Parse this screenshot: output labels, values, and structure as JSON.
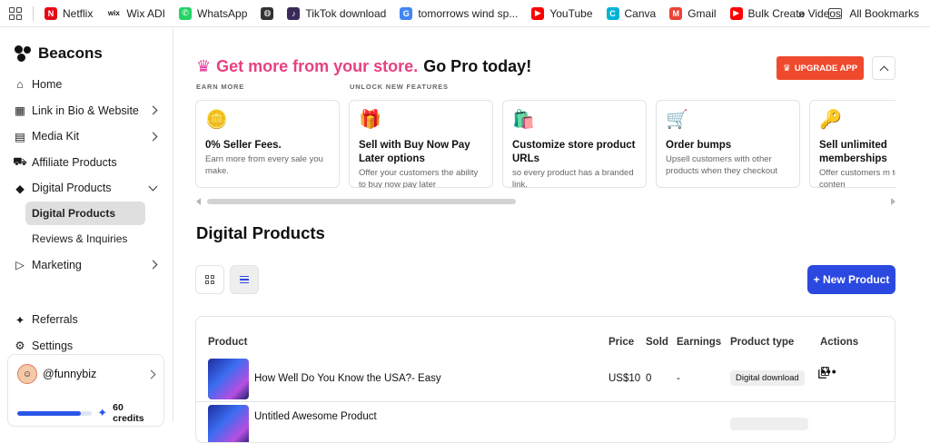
{
  "bookmarks": [
    {
      "label": "Netflix",
      "icon": "netflix-icon",
      "color": "#e50914",
      "glyph": "N"
    },
    {
      "label": "Wix ADI",
      "icon": "wix-icon",
      "color": "#111111",
      "glyph": "wix"
    },
    {
      "label": "WhatsApp",
      "icon": "whatsapp-icon",
      "color": "#25d366",
      "glyph": "✆"
    },
    {
      "label": "",
      "icon": "globe-icon",
      "color": "#333333",
      "glyph": "◍"
    },
    {
      "label": "TikTok download",
      "icon": "tiktok-icon",
      "color": "#3a2a5a",
      "glyph": "♪"
    },
    {
      "label": "tomorrows wind sp...",
      "icon": "google-icon",
      "color": "#4285f4",
      "glyph": "G"
    },
    {
      "label": "YouTube",
      "icon": "youtube-icon",
      "color": "#ff0000",
      "glyph": "▶"
    },
    {
      "label": "Canva",
      "icon": "canva-icon",
      "color": "#00b3d6",
      "glyph": "C"
    },
    {
      "label": "Gmail",
      "icon": "gmail-icon",
      "color": "#ea4335",
      "glyph": "M"
    },
    {
      "label": "Bulk Create Videos",
      "icon": "youtube-icon",
      "color": "#ff0000",
      "glyph": "▶"
    }
  ],
  "bookmarks_more": "»",
  "all_bookmarks": "All Bookmarks",
  "logo": "Beacons",
  "nav": [
    {
      "label": "Home",
      "icon": "home-icon",
      "glyph": "⌂",
      "chevron": false
    },
    {
      "label": "Link in Bio & Website",
      "icon": "link-in-bio-icon",
      "glyph": "▦",
      "chevron": true
    },
    {
      "label": "Media Kit",
      "icon": "media-kit-icon",
      "glyph": "▤",
      "chevron": true
    },
    {
      "label": "Affiliate Products",
      "icon": "cart-icon",
      "glyph": "⛟",
      "chevron": false
    },
    {
      "label": "Digital Products",
      "icon": "tag-icon",
      "glyph": "◆",
      "chevron": "down"
    }
  ],
  "subnav": [
    "Digital Products",
    "Reviews & Inquiries"
  ],
  "nav_marketing": {
    "label": "Marketing",
    "icon": "marketing-icon",
    "glyph": "▷"
  },
  "nav_bottom": [
    {
      "label": "Referrals",
      "icon": "gift-icon",
      "glyph": "✦"
    },
    {
      "label": "Settings",
      "icon": "gear-icon",
      "glyph": "⚙"
    }
  ],
  "profile": {
    "handle": "@funnybiz",
    "credits": "60 credits",
    "credit_fill": 0.85
  },
  "promo": {
    "headline_colored": "Get more from your store.",
    "headline_plain": "Go Pro today!",
    "upgrade": "UPGRADE APP",
    "earn_more": "EARN MORE",
    "unlock": "UNLOCK NEW FEATURES"
  },
  "feature_cards": [
    {
      "emoji": "🪙",
      "title": "0% Seller Fees.",
      "desc": "Earn more from every sale you make."
    },
    {
      "emoji": "🎁",
      "title": "Sell with Buy Now Pay Later options",
      "desc": "Offer your customers the ability to buy now pay later"
    },
    {
      "emoji": "🛍️",
      "title": "Customize store product URLs",
      "desc": "so every product has a branded link."
    },
    {
      "emoji": "🛒",
      "title": "Order bumps",
      "desc": "Upsell customers with other products when they checkout"
    },
    {
      "emoji": "🔑",
      "title": "Sell unlimited memberships",
      "desc": "Offer customers m to exclusive conten"
    }
  ],
  "section_title": "Digital Products",
  "new_product": "+ New Product",
  "table": {
    "headers": [
      "Product",
      "Price",
      "Sold",
      "Earnings",
      "Product type",
      "Actions"
    ],
    "rows": [
      {
        "name": "How Well Do You Know the USA?- Easy",
        "price": "US$10",
        "sold": "0",
        "earnings": "-",
        "type": "Digital download"
      },
      {
        "name": "Untitled Awesome Product",
        "price": "",
        "sold": "",
        "earnings": "",
        "type": ""
      }
    ]
  }
}
